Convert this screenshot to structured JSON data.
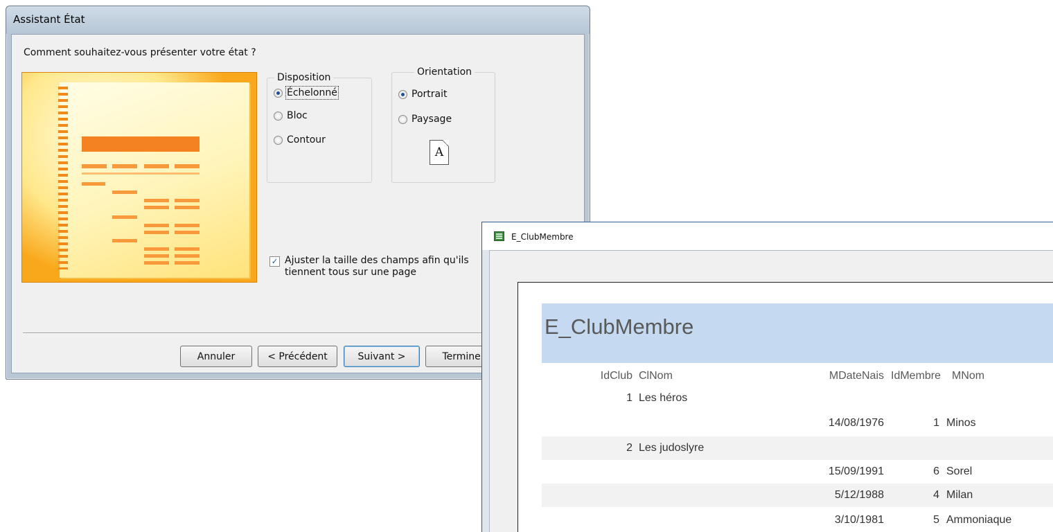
{
  "wizard": {
    "title": "Assistant État",
    "question": "Comment souhaitez-vous présenter votre état ?",
    "layout": {
      "legend": "Disposition",
      "options": [
        {
          "label": "Échelonné",
          "selected": true
        },
        {
          "label": "Bloc",
          "selected": false
        },
        {
          "label": "Contour",
          "selected": false
        }
      ]
    },
    "orientation": {
      "legend": "Orientation",
      "options": [
        {
          "label": "Portrait",
          "selected": true
        },
        {
          "label": "Paysage",
          "selected": false
        }
      ],
      "icon_letter": "A"
    },
    "fit_checkbox": {
      "line1": "Ajuster la taille des champs afin qu'ils",
      "line2": "tiennent tous sur une page",
      "checked": true
    },
    "buttons": {
      "cancel": "Annuler",
      "previous": "< Précédent",
      "next": "Suivant >",
      "finish": "Terminer"
    }
  },
  "report": {
    "window_title": "E_ClubMembre",
    "title": "E_ClubMembre",
    "headers": {
      "idclub": "IdClub",
      "clnom": "ClNom",
      "mdatenais": "MDateNais",
      "idmembre": "IdMembre",
      "mnom": "MNom"
    },
    "rows": [
      {
        "idclub": "1",
        "clnom": "Les héros",
        "mdatenais": "",
        "idmembre": "",
        "mnom": ""
      },
      {
        "idclub": "",
        "clnom": "",
        "mdatenais": "14/08/1976",
        "idmembre": "1",
        "mnom": "Minos"
      },
      {
        "idclub": "2",
        "clnom": "Les judoslyre",
        "mdatenais": "",
        "idmembre": "",
        "mnom": ""
      },
      {
        "idclub": "",
        "clnom": "",
        "mdatenais": "15/09/1991",
        "idmembre": "6",
        "mnom": "Sorel"
      },
      {
        "idclub": "",
        "clnom": "",
        "mdatenais": "5/12/1988",
        "idmembre": "4",
        "mnom": "Milan"
      },
      {
        "idclub": "",
        "clnom": "",
        "mdatenais": "3/10/1981",
        "idmembre": "5",
        "mnom": "Ammoniaque"
      }
    ],
    "colors": {
      "title_band": "#c5d9f1",
      "stripe": "#f2f2f2"
    }
  }
}
